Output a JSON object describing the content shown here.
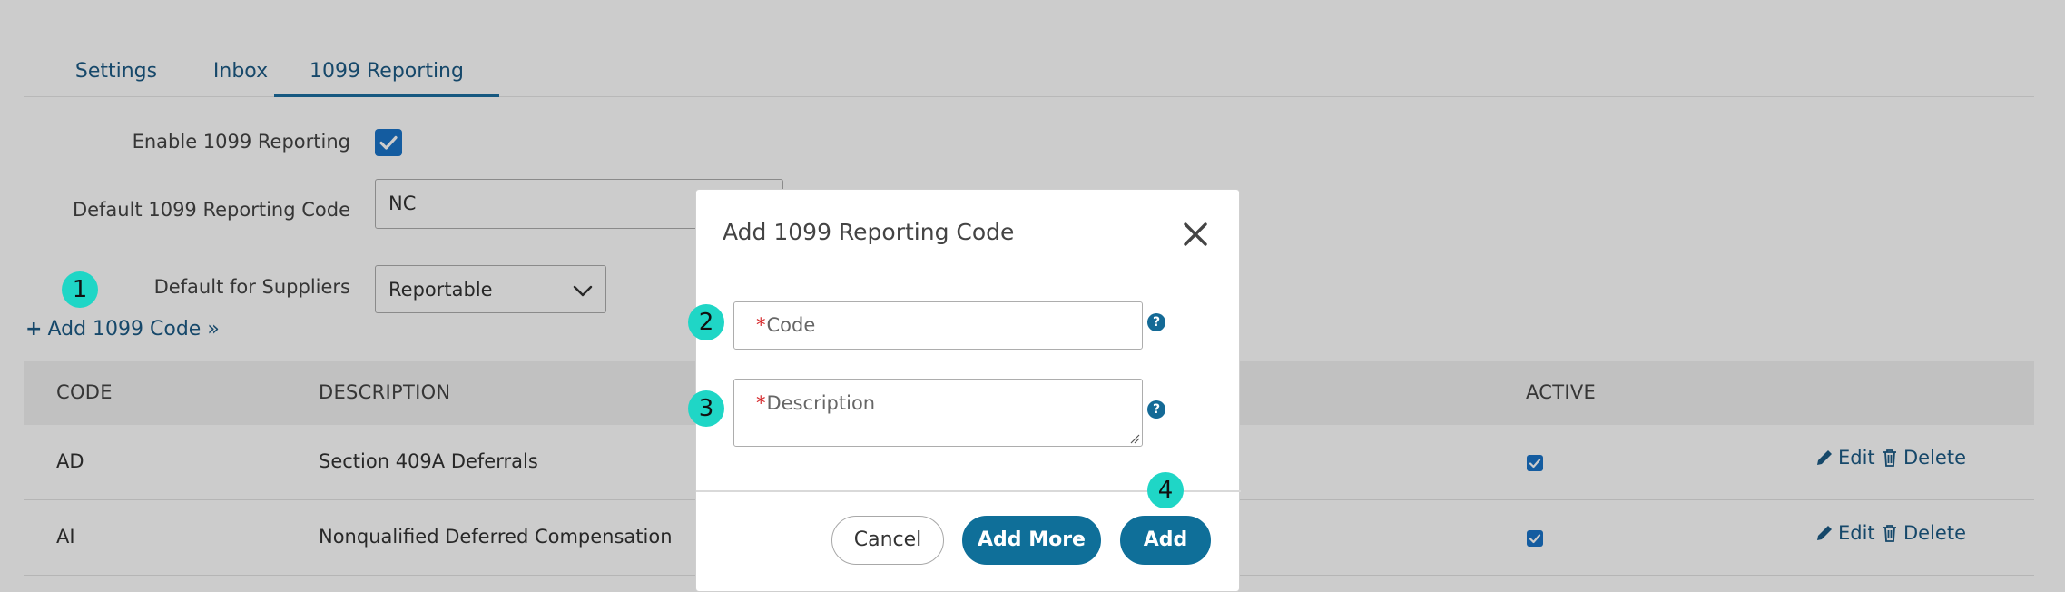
{
  "tabs": [
    {
      "label": "Settings"
    },
    {
      "label": "Inbox"
    },
    {
      "label": "1099 Reporting"
    }
  ],
  "form": {
    "enable_label": "Enable 1099 Reporting",
    "enable_checked": true,
    "default_code_label": "Default 1099 Reporting Code",
    "default_code_value": "NC",
    "default_suppliers_label": "Default for Suppliers",
    "default_suppliers_value": "Reportable"
  },
  "add_code_link": {
    "label": "Add 1099 Code »"
  },
  "table": {
    "columns": [
      "CODE",
      "DESCRIPTION",
      "ACTIVE"
    ],
    "rows": [
      {
        "code": "AD",
        "description": "Section 409A Deferrals",
        "active": true,
        "edit": "Edit",
        "delete": "Delete"
      },
      {
        "code": "AI",
        "description": "Nonqualified Deferred Compensation",
        "active": true,
        "edit": "Edit",
        "delete": "Delete"
      }
    ]
  },
  "modal": {
    "title": "Add 1099 Reporting Code",
    "code_field": {
      "required_mark": "*",
      "placeholder": "Code"
    },
    "description_field": {
      "required_mark": "*",
      "placeholder": "Description"
    },
    "help_glyph": "?",
    "buttons": {
      "cancel": "Cancel",
      "add_more": "Add More",
      "add": "Add"
    }
  },
  "badges": [
    "1",
    "2",
    "3",
    "4"
  ],
  "colors": {
    "link": "#1c5a85",
    "primary_button": "#0f6f99",
    "checkbox": "#1a73c9",
    "badge": "#1fd6c6",
    "required": "#d6282b"
  }
}
